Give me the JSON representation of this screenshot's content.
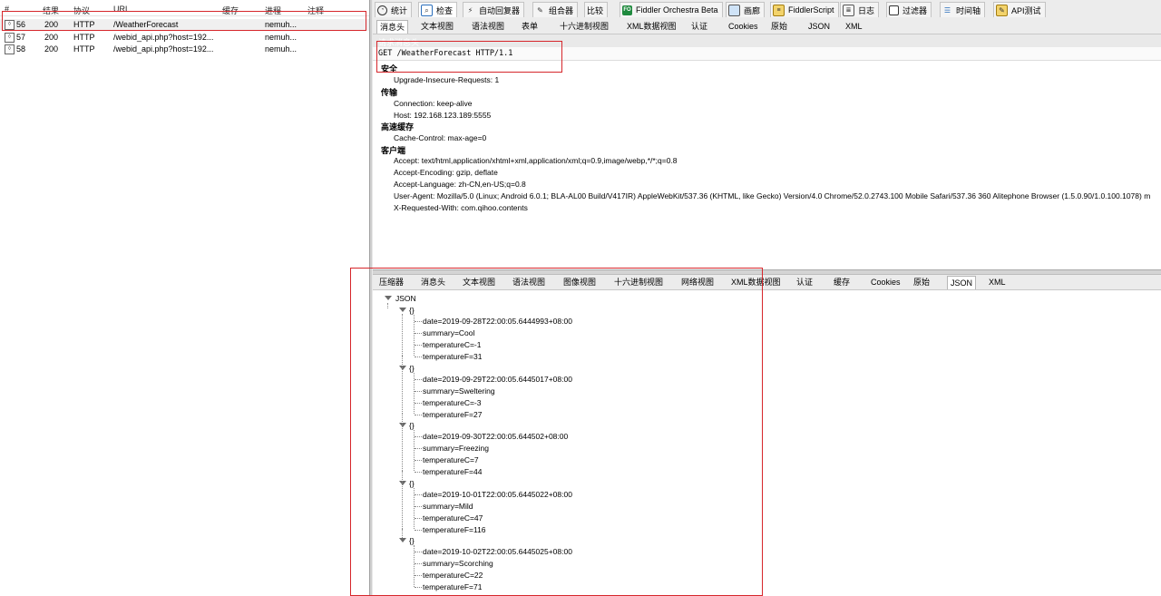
{
  "sessions": {
    "columns": [
      "#",
      "结果",
      "协议",
      "URL",
      "缓存",
      "进程",
      "注释"
    ],
    "rows": [
      {
        "id": "56",
        "result": "200",
        "protocol": "HTTP",
        "url": "/WeatherForecast",
        "cache": "",
        "process": "nemuh...",
        "comment": ""
      },
      {
        "id": "57",
        "result": "200",
        "protocol": "HTTP",
        "url": "/webid_api.php?host=192...",
        "cache": "",
        "process": "nemuh...",
        "comment": ""
      },
      {
        "id": "58",
        "result": "200",
        "protocol": "HTTP",
        "url": "/webid_api.php?host=192...",
        "cache": "",
        "process": "nemuh...",
        "comment": ""
      }
    ]
  },
  "top_tabs": [
    {
      "label": "统计",
      "icon": "timer-icon"
    },
    {
      "label": "检查",
      "icon": "inspect-icon"
    },
    {
      "label": "自动回复器",
      "icon": "lightning-icon"
    },
    {
      "label": "组合器",
      "icon": "compose-icon"
    },
    {
      "label": "比较",
      "icon": ""
    },
    {
      "label": "Fiddler Orchestra Beta",
      "icon": "fo-icon",
      "icon_text": "FO"
    },
    {
      "label": "画廊",
      "icon": "gallery-icon"
    },
    {
      "label": "FiddlerScript",
      "icon": "script-icon"
    },
    {
      "label": "日志",
      "icon": "log-icon"
    },
    {
      "label": "过滤器",
      "icon": "checkbox-icon"
    },
    {
      "label": "时间轴",
      "icon": "timeline-icon"
    },
    {
      "label": "API测试",
      "icon": "api-test-icon"
    }
  ],
  "request_tabs": [
    "消息头",
    "文本视图",
    "语法视图",
    "表单",
    "十六进制视图",
    "XML数据视图",
    "认证",
    "Cookies",
    "原始",
    "JSON",
    "XML"
  ],
  "request_header_title": "请求消息头",
  "request_line": "GET /WeatherForecast HTTP/1.1",
  "header_groups": [
    {
      "name": "安全",
      "lines": [
        "Upgrade-Insecure-Requests: 1"
      ]
    },
    {
      "name": "传输",
      "lines": [
        "Connection: keep-alive",
        "Host: 192.168.123.189:5555"
      ]
    },
    {
      "name": "高速缓存",
      "lines": [
        "Cache-Control: max-age=0"
      ]
    },
    {
      "name": "客户端",
      "lines": [
        "Accept: text/html,application/xhtml+xml,application/xml;q=0.9,image/webp,*/*;q=0.8",
        "Accept-Encoding: gzip, deflate",
        "Accept-Language: zh-CN,en-US;q=0.8",
        "User-Agent: Mozilla/5.0 (Linux; Android 6.0.1; BLA-AL00 Build/V417IR) AppleWebKit/537.36 (KHTML, like Gecko) Version/4.0 Chrome/52.0.2743.100 Mobile Safari/537.36 360 Alitephone Browser (1.5.0.90/1.0.100.1078) m",
        "X-Requested-With: com.qihoo.contents"
      ]
    }
  ],
  "response_tabs": [
    "压缩器",
    "消息头",
    "文本视图",
    "语法视图",
    "图像视图",
    "十六进制视图",
    "网络视图",
    "XML数据视图",
    "认证",
    "缓存",
    "Cookies",
    "原始",
    "JSON",
    "XML"
  ],
  "json_tree": {
    "root": "JSON",
    "object_label": "{}",
    "items": [
      [
        "date=2019-09-28T22:00:05.6444993+08:00",
        "summary=Cool",
        "temperatureC=-1",
        "temperatureF=31"
      ],
      [
        "date=2019-09-29T22:00:05.6445017+08:00",
        "summary=Sweltering",
        "temperatureC=-3",
        "temperatureF=27"
      ],
      [
        "date=2019-09-30T22:00:05.644502+08:00",
        "summary=Freezing",
        "temperatureC=7",
        "temperatureF=44"
      ],
      [
        "date=2019-10-01T22:00:05.6445022+08:00",
        "summary=Mild",
        "temperatureC=47",
        "temperatureF=116"
      ],
      [
        "date=2019-10-02T22:00:05.6445025+08:00",
        "summary=Scorching",
        "temperatureC=22",
        "temperatureF=71"
      ]
    ]
  },
  "colors": {
    "annotation_red": "#d6262b",
    "selected_row": "#f0f0f0"
  }
}
